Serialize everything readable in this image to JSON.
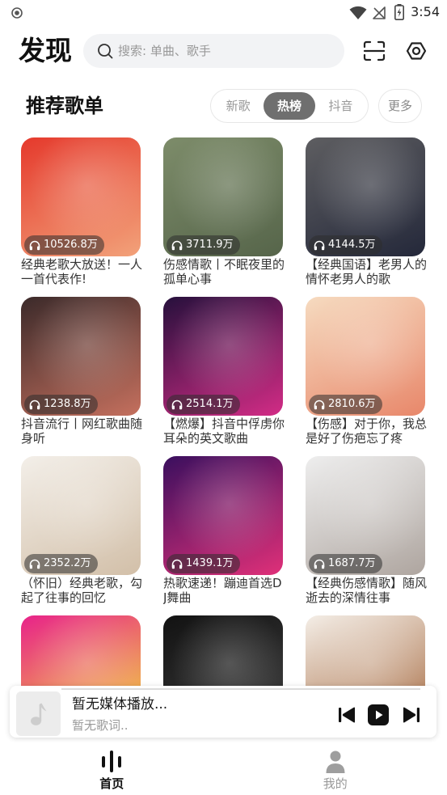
{
  "status_bar": {
    "time": "3:54"
  },
  "header": {
    "title": "发现",
    "search_placeholder": "搜索: 单曲、歌手",
    "icons": [
      "search-icon",
      "scan-icon",
      "gear-icon"
    ]
  },
  "section": {
    "title": "推荐歌单",
    "tabs": [
      {
        "label": "新歌",
        "active": false
      },
      {
        "label": "热榜",
        "active": true
      },
      {
        "label": "抖音",
        "active": false
      }
    ],
    "more_label": "更多"
  },
  "playlists": [
    {
      "title": "经典老歌大放送！一人一首代表作!",
      "play_count": "10526.8万",
      "cover_colors": [
        "#e5392c",
        "#f2a27a"
      ]
    },
    {
      "title": "伤感情歌丨不眠夜里的孤单心事",
      "play_count": "3711.9万",
      "cover_colors": [
        "#7d8c6a",
        "#56654a"
      ]
    },
    {
      "title": "【经典国语】老男人的情怀老男人的歌",
      "play_count": "4144.5万",
      "cover_colors": [
        "#5e5e61",
        "#24283a"
      ]
    },
    {
      "title": "抖音流行丨网红歌曲随身听",
      "play_count": "1238.8万",
      "cover_colors": [
        "#3b2a2a",
        "#c5705e"
      ]
    },
    {
      "title": "【燃爆】抖音中俘虏你耳朵的英文歌曲",
      "play_count": "2514.1万",
      "cover_colors": [
        "#26103c",
        "#d32c86"
      ]
    },
    {
      "title": "【伤感】对于你，我总是好了伤疤忘了疼",
      "play_count": "2810.6万",
      "cover_colors": [
        "#f6dbc0",
        "#e8876a"
      ]
    },
    {
      "title": "（怀旧）经典老歌，勾起了往事的回忆",
      "play_count": "2352.2万",
      "cover_colors": [
        "#f3efe9",
        "#d2bfa8"
      ]
    },
    {
      "title": "热歌速递！蹦迪首选DJ舞曲",
      "play_count": "1439.1万",
      "cover_colors": [
        "#3a0f5e",
        "#e03079"
      ]
    },
    {
      "title": "【经典伤感情歌】随风逝去的深情往事",
      "play_count": "1687.7万",
      "cover_colors": [
        "#eeeeee",
        "#aea59f"
      ]
    }
  ],
  "partially_visible_playlists": [
    {
      "cover_colors": [
        "#e8228a",
        "#f2dd3a"
      ]
    },
    {
      "cover_colors": [
        "#121212",
        "#404040"
      ]
    },
    {
      "cover_colors": [
        "#f4eee7",
        "#a3653a"
      ]
    }
  ],
  "player": {
    "title": "暂无媒体播放...",
    "lyrics": "暂无歌词..",
    "progress": 0
  },
  "nav": [
    {
      "label": "首页",
      "icon": "equalizer-icon",
      "active": true
    },
    {
      "label": "我的",
      "icon": "person-icon",
      "active": false
    }
  ],
  "theme": {
    "text_primary": "#222222",
    "text_secondary": "#999999",
    "tab_active_bg": "#6f6f6f",
    "surface_muted": "#f2f3f5"
  }
}
